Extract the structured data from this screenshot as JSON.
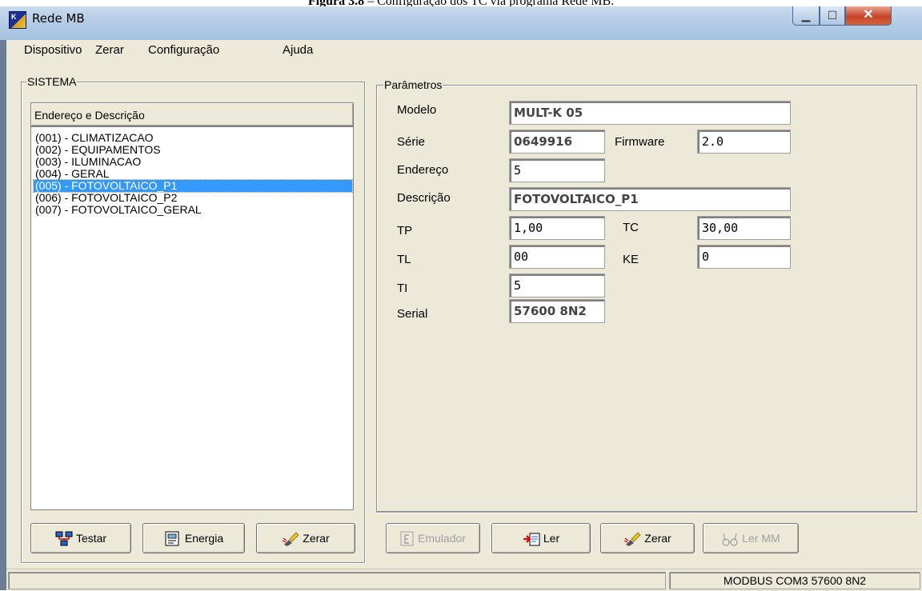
{
  "caption": {
    "label": "Figura 3.8",
    "text": " – Configuração dos TC via programa Rede MB."
  },
  "window": {
    "title": "Rede MB",
    "icon": "app-icon",
    "controls": {
      "minimize": "minimize-icon",
      "maximize": "maximize-icon",
      "close": "close-icon"
    }
  },
  "menu": {
    "items": [
      "Dispositivo",
      "Zerar",
      "Configuração",
      "Ajuda"
    ]
  },
  "system": {
    "legend": "SISTEMA",
    "list_header": "Endereço e Descrição",
    "items": [
      "(001) - CLIMATIZACAO",
      "(002) - EQUIPAMENTOS",
      "(003) - ILUMINACAO",
      "(004) - GERAL",
      "(005) - FOTOVOLTAICO_P1",
      "(006) - FOTOVOLTAICO_P2",
      "(007) - FOTOVOLTAICO_GERAL"
    ],
    "selected_index": 4,
    "buttons": {
      "testar": {
        "label": "Testar",
        "icon": "network-icon"
      },
      "energia": {
        "label": "Energia",
        "icon": "meter-icon"
      },
      "zerar": {
        "label": "Zerar",
        "icon": "eraser-icon"
      }
    }
  },
  "params": {
    "legend": "Parâmetros",
    "modelo": {
      "label": "Modelo",
      "value": "MULT-K 05"
    },
    "serie": {
      "label": "Série",
      "value": "0649916"
    },
    "firmware": {
      "label": "Firmware",
      "value": "2.0"
    },
    "endereco": {
      "label": "Endereço",
      "value": "5"
    },
    "descricao": {
      "label": "Descrição",
      "value": "FOTOVOLTAICO_P1"
    },
    "tp": {
      "label": "TP",
      "value": "1,00"
    },
    "tc": {
      "label": "TC",
      "value": "30,00"
    },
    "tl": {
      "label": "TL",
      "value": "00"
    },
    "ke": {
      "label": "KE",
      "value": "0"
    },
    "ti": {
      "label": "TI",
      "value": "5"
    },
    "serial": {
      "label": "Serial",
      "value": "57600 8N2"
    },
    "buttons": {
      "emulador": {
        "label": "Emulador",
        "icon": "emulator-icon"
      },
      "ler": {
        "label": "Ler",
        "icon": "read-icon"
      },
      "zerar": {
        "label": "Zerar",
        "icon": "eraser-icon"
      },
      "ler_mm": {
        "label": "Ler MM",
        "icon": "glasses-icon"
      }
    }
  },
  "status": {
    "connection": "MODBUS COM3 57600 8N2"
  }
}
